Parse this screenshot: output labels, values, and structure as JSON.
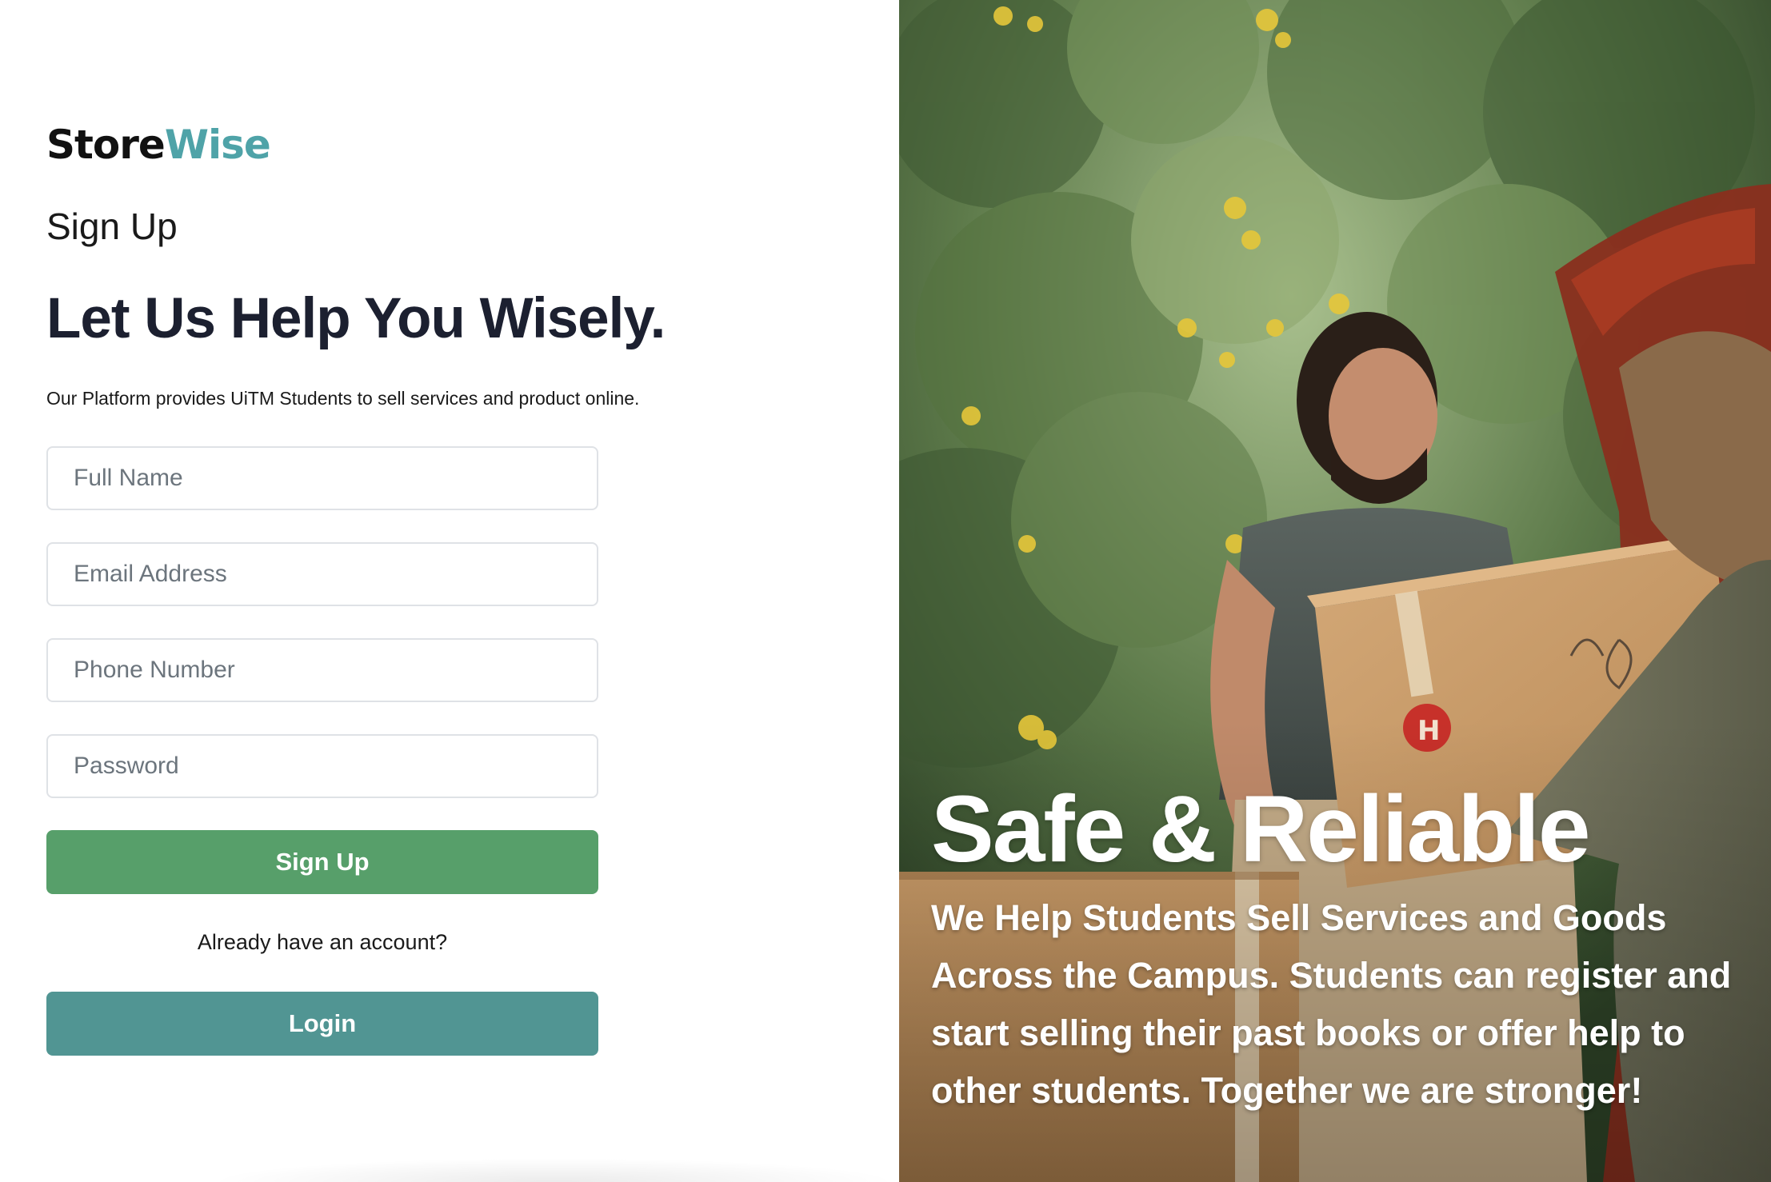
{
  "brand": {
    "logo_part_a": "Store",
    "logo_part_b": "Wise",
    "colors": {
      "logo_dark": "#111111",
      "logo_accent": "#4fa3a8"
    }
  },
  "form": {
    "section_title": "Sign Up",
    "headline": "Let Us Help You Wisely.",
    "subtitle": "Our Platform provides UiTM Students to sell services and product online.",
    "fields": {
      "full_name_placeholder": "Full Name",
      "email_placeholder": "Email Address",
      "phone_placeholder": "Phone Number",
      "password_placeholder": "Password"
    },
    "signup_button_label": "Sign Up",
    "already_account_text": "Already have an account?",
    "login_button_label": "Login",
    "colors": {
      "signup_button": "#579f6a",
      "login_button": "#519593"
    }
  },
  "hero": {
    "title": "Safe & Reliable",
    "description": "We Help Students Sell Services and Goods Across the Campus. Students can register and start selling their past books or offer help to other students. Together we are stronger!",
    "image_description_icon": "photo-person-carrying-box"
  }
}
